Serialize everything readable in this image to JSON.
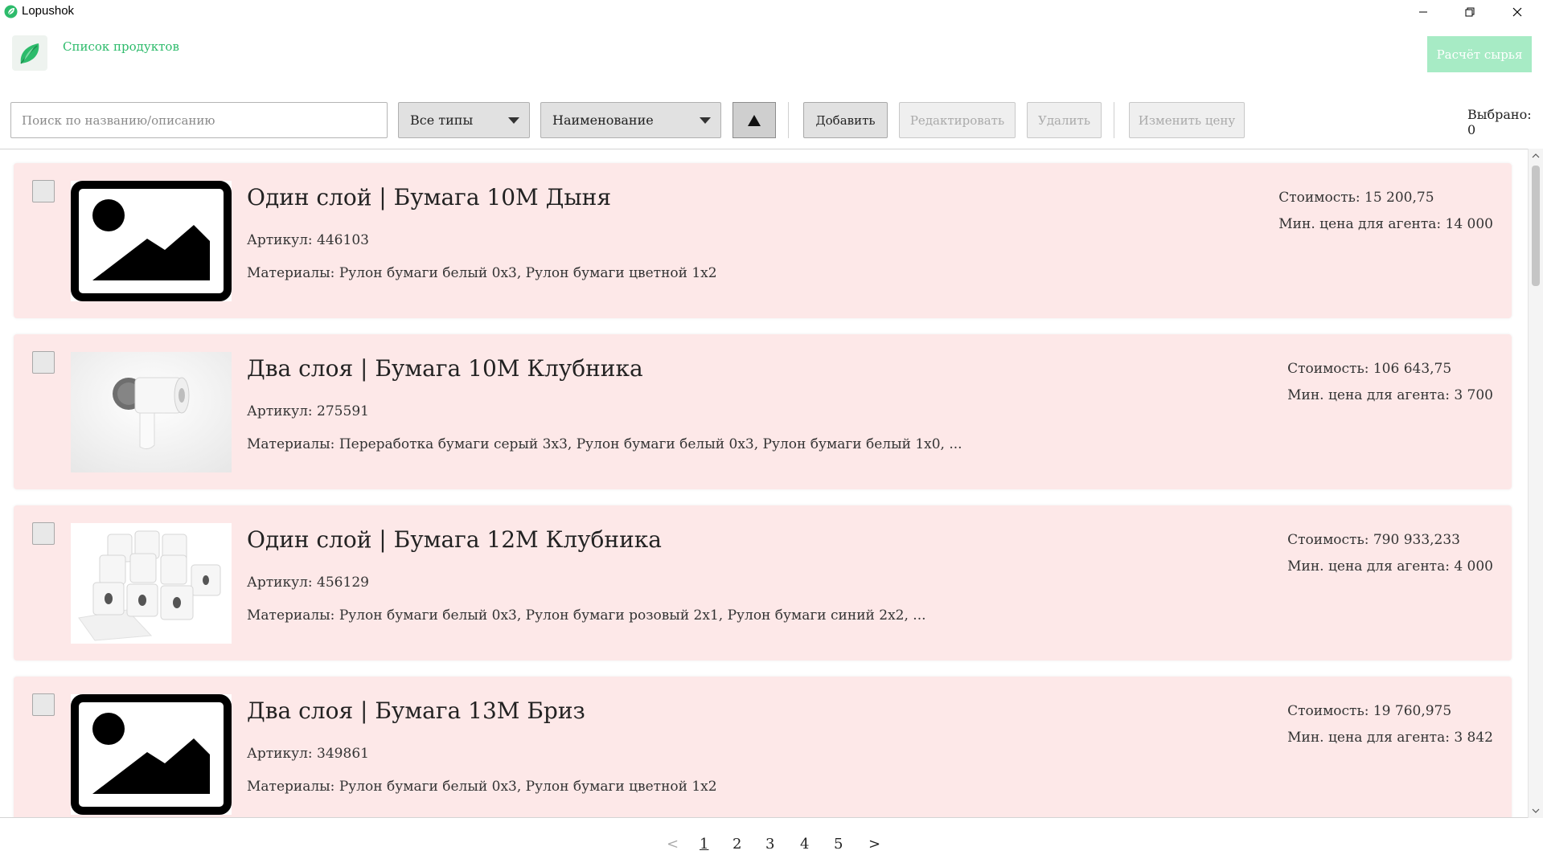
{
  "window": {
    "title": "Lopushok"
  },
  "header": {
    "page_title": "Список продуктов",
    "raw_button": "Расчёт сырья"
  },
  "toolbar": {
    "search_placeholder": "Поиск по названию/описанию",
    "type_filter": "Все типы",
    "sort_field": "Наименование",
    "add_label": "Добавить",
    "edit_label": "Редактировать",
    "delete_label": "Удалить",
    "change_price_label": "Изменить цену",
    "selected_count": "Выбрано: 0"
  },
  "products": [
    {
      "title": "Один слой | Бумага 10М Дыня",
      "article": "Артикул: 446103",
      "materials": "Материалы: Рулон бумаги белый 0x3, Рулон бумаги цветной 1x2",
      "cost": "Стоимость: 15 200,75",
      "min_price": "Мин. цена для агента: 14 000",
      "image": "placeholder-image-icon"
    },
    {
      "title": "Два слоя | Бумага 10М Клубника",
      "article": "Артикул: 275591",
      "materials": "Материалы: Переработка бумаги серый 3x3, Рулон бумаги белый 0x3, Рулон бумаги белый 1x0, ...",
      "cost": "Стоимость: 106 643,75",
      "min_price": "Мин. цена для агента: 3 700",
      "image": "toilet-paper-holder-photo"
    },
    {
      "title": "Один слой | Бумага 12М Клубника",
      "article": "Артикул: 456129",
      "materials": "Материалы: Рулон бумаги белый 0x3, Рулон бумаги розовый 2x1, Рулон бумаги синий 2x2, ...",
      "cost": "Стоимость: 790 933,233",
      "min_price": "Мин. цена для агента: 4 000",
      "image": "toilet-paper-rolls-photo"
    },
    {
      "title": "Два слоя | Бумага 13М Бриз",
      "article": "Артикул: 349861",
      "materials": "Материалы: Рулон бумаги белый 0x3, Рулон бумаги цветной 1x2",
      "cost": "Стоимость: 19 760,975",
      "min_price": "Мин. цена для агента: 3 842",
      "image": "placeholder-image-icon"
    }
  ],
  "pagination": {
    "prev": "<",
    "pages": [
      "1",
      "2",
      "3",
      "4",
      "5"
    ],
    "next": ">",
    "current": "1"
  },
  "colors": {
    "accent": "#2dbb6b",
    "accent_disabled": "#a7ebc5",
    "card_bg": "#fde8e8"
  }
}
